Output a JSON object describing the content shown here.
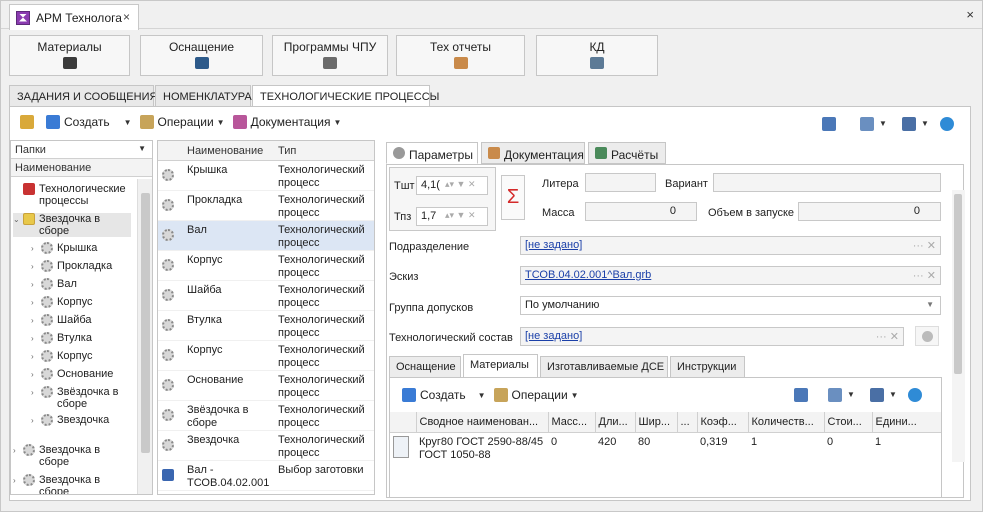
{
  "window": {
    "app_tab": "АРМ Технолога",
    "close": "×"
  },
  "modules": [
    {
      "label": "Материалы",
      "icon": "bucket-icon",
      "color": "#3b3b3b"
    },
    {
      "label": "Оснащение",
      "icon": "drill-icon",
      "color": "#2d5a8a"
    },
    {
      "label": "Программы ЧПУ",
      "icon": "cnc-icon",
      "color": "#6b6b6b"
    },
    {
      "label": "Тех отчеты",
      "icon": "report-icon",
      "color": "#c98a4a"
    },
    {
      "label": "КД",
      "icon": "cad-icon",
      "color": "#5c7a96"
    }
  ],
  "module_tabs": [
    "ЗАДАНИЯ И СООБЩЕНИЯ",
    "НОМЕНКЛАТУРА",
    "ТЕХНОЛОГИЧЕСКИЕ ПРОЦЕССЫ"
  ],
  "toolbar": {
    "create": "Создать",
    "operations": "Операции",
    "documentation": "Документация"
  },
  "folders": {
    "header": "Папки",
    "column": "Наименование",
    "items": [
      {
        "label": "Технологические процессы",
        "level": 0,
        "arrow": ""
      },
      {
        "label": "Звездочка в сборе",
        "level": 0,
        "arrow": "⌄"
      },
      {
        "label": "Крышка",
        "level": 1,
        "arrow": "›"
      },
      {
        "label": "Прокладка",
        "level": 1,
        "arrow": "›"
      },
      {
        "label": "Вал",
        "level": 1,
        "arrow": "›"
      },
      {
        "label": "Корпус",
        "level": 1,
        "arrow": "›"
      },
      {
        "label": "Шайба",
        "level": 1,
        "arrow": "›"
      },
      {
        "label": "Втулка",
        "level": 1,
        "arrow": "›"
      },
      {
        "label": "Корпус",
        "level": 1,
        "arrow": "›"
      },
      {
        "label": "Основание",
        "level": 1,
        "arrow": "›"
      },
      {
        "label": "Звёздочка в сборе",
        "level": 1,
        "arrow": "›"
      },
      {
        "label": "Звездочка",
        "level": 1,
        "arrow": "›"
      },
      {
        "label": "Звездочка в сборе",
        "level": 0,
        "arrow": "›"
      },
      {
        "label": "Звездочка в сборе",
        "level": 0,
        "arrow": "›"
      }
    ]
  },
  "list": {
    "col_name": "Наименование",
    "col_type": "Тип",
    "rows": [
      {
        "name": "Крышка",
        "type": "Технологический процесс"
      },
      {
        "name": "Прокладка",
        "type": "Технологический процесс"
      },
      {
        "name": "Вал",
        "type": "Технологический процесс",
        "selected": true
      },
      {
        "name": "Корпус",
        "type": "Технологический процесс"
      },
      {
        "name": "Шайба",
        "type": "Технологический процесс"
      },
      {
        "name": "Втулка",
        "type": "Технологический процесс"
      },
      {
        "name": "Корпус",
        "type": "Технологический процесс"
      },
      {
        "name": "Основание",
        "type": "Технологический процесс"
      },
      {
        "name": "Звёздочка в сборе",
        "type": "Технологический процесс"
      },
      {
        "name": "Звездочка",
        "type": "Технологический процесс"
      },
      {
        "name": "Вал - ТСОВ.04.02.001",
        "type": "Выбор заготовки"
      }
    ]
  },
  "right_tabs": [
    "Параметры",
    "Документация",
    "Расчёты"
  ],
  "params": {
    "tsht_label": "Тшт",
    "tsht_value": "4,1(",
    "tpz_label": "Тпз",
    "tpz_value": "1,7",
    "sigma": "Σ",
    "litera_label": "Литера",
    "variant_label": "Вариант",
    "massa_label": "Масса",
    "massa_value": "0",
    "obem_label": "Объем в запуске",
    "obem_value": "0",
    "podrazd_label": "Подразделение",
    "podrazd_value": "[не задано]",
    "eskiz_label": "Эскиз",
    "eskiz_value": "ТСОВ.04.02.001^Вал.grb",
    "gruppa_label": "Группа допусков",
    "gruppa_value": "По умолчанию",
    "sostav_label": "Технологический состав",
    "sostav_value": "[не задано]"
  },
  "sub_tabs": [
    "Оснащение",
    "Материалы",
    "Изготавливаемые ДСЕ",
    "Инструкции"
  ],
  "sub_toolbar": {
    "create": "Создать",
    "operations": "Операции"
  },
  "materials": {
    "columns": [
      "Сводное наименован...",
      "Масс...",
      "Дли...",
      "Шир...",
      "...",
      "Коэф...",
      "Количеств...",
      "Стои...",
      "Едини..."
    ],
    "rows": [
      [
        "Круг80 ГОСТ 2590-88/45 ГОСТ 1050-88",
        "0",
        "420",
        "80",
        "",
        "0,319",
        "1",
        "0",
        "1"
      ]
    ]
  }
}
